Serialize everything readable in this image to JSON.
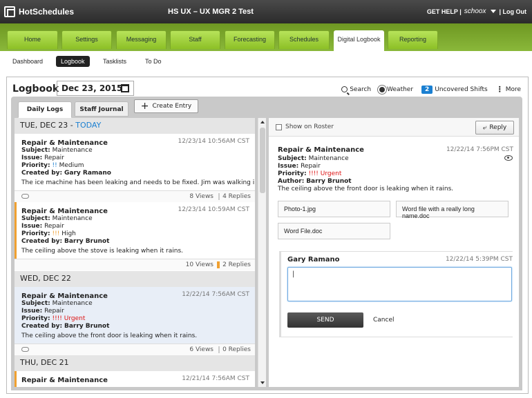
{
  "topbar": {
    "logo_text": "HotSchedules",
    "title": "HS UX  –  UX MGR 2 Test",
    "help": "GET HELP |",
    "brand": "schoox",
    "logout": "| Log Out"
  },
  "nav": {
    "tabs": [
      "Home",
      "Settings",
      "Messaging",
      "Staff",
      "Forecasting",
      "Schedules",
      "Digital Logbook",
      "Reporting"
    ],
    "active": "Digital Logbook"
  },
  "subnav": {
    "items": [
      "Dashboard",
      "Logbook",
      "Tasklists",
      "To Do"
    ],
    "active": "Logbook"
  },
  "header": {
    "title": "Logbook",
    "date": "Dec 23, 2015",
    "search_label": "Search",
    "weather_label": "Weather",
    "uncovered_count": "2",
    "uncovered_label": "Uncovered Shifts",
    "more_label": "More"
  },
  "tabs": {
    "daily_logs": "Daily Logs",
    "staff_journal": "Staff Journal",
    "create_entry": "Create Entry"
  },
  "list": {
    "day1": {
      "label": "TUE, DEC 23 - ",
      "today": "TODAY"
    },
    "day2": {
      "label": "WED, DEC 22"
    },
    "day3": {
      "label": "THU, DEC 21"
    },
    "entries": [
      {
        "title": "Repair & Maintenance",
        "time": "12/23/14 10:56AM CST",
        "subject_k": "Subject:",
        "subject": "Maintenance",
        "issue_k": "Issue:",
        "issue": "Repair",
        "priority_k": "Priority:",
        "priority_mark": "!!",
        "priority": "Medium",
        "creator_k": "Created by:",
        "creator": "Gary Ramano",
        "body": "The ice machine has been leaking and needs to be fixed. Jim was walking in ...",
        "views": "8 Views",
        "replies": "4 Replies"
      },
      {
        "title": "Repair & Maintenance",
        "time": "12/23/14 10:59AM CST",
        "subject_k": "Subject:",
        "subject": "Maintenance",
        "issue_k": "Issue:",
        "issue": "Repair",
        "priority_k": "Priority:",
        "priority_mark": "!!!",
        "priority": "High",
        "creator_k": "Created by:",
        "creator": "Barry Brunot",
        "body": "The ceiling above the stove is leaking when it rains.",
        "views": "10 Views",
        "replies": "2 Replies"
      },
      {
        "title": "Repair & Maintenance",
        "time": "12/22/14 7:56AM CST",
        "subject_k": "Subject:",
        "subject": "Maintenance",
        "issue_k": "Issue:",
        "issue": "Repair",
        "priority_k": "Priority:",
        "priority_mark": "!!!!",
        "priority": "Urgent",
        "creator_k": "Created by:",
        "creator": "Barry Brunot",
        "body": "The ceiling above the front door is leaking when it rains.",
        "views": "6 Views",
        "replies": "0 Replies"
      },
      {
        "title": "Repair & Maintenance",
        "time": "12/21/14 7:56AM CST"
      }
    ]
  },
  "detail": {
    "show_on_roster": "Show on Roster",
    "reply": "Reply",
    "title": "Repair & Maintenance",
    "time": "12/22/14 7:56PM CST",
    "subject_k": "Subject:",
    "subject": "Maintenance",
    "issue_k": "Issue:",
    "issue": "Repair",
    "priority_k": "Priority:",
    "priority_mark": "!!!!",
    "priority": "Urgent",
    "author_k": "Author:",
    "author": "Barry Brunot",
    "body": "The ceiling above the front door is leaking when it rains.",
    "attachments": [
      "Photo-1.jpg",
      "Word file with a really long name.doc",
      "Word File.doc"
    ],
    "comment": {
      "name": "Gary Ramano",
      "time": "12/22/14 5:39PM CST",
      "input_value": "|",
      "send": "SEND",
      "cancel": "Cancel"
    }
  },
  "colors": {
    "accent": "#1a7fd1",
    "urgent": "#dd1111",
    "high": "#f0a030",
    "nav_green": "#8ab83a"
  }
}
